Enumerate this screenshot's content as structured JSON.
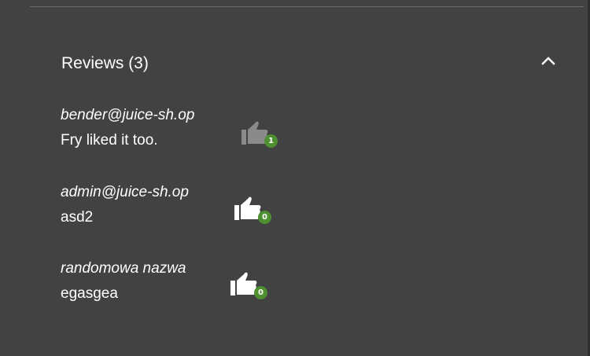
{
  "reviews_panel": {
    "title": "Reviews (3)",
    "collapse_icon": "chevron-up-icon"
  },
  "reviews": [
    {
      "author": "bender@juice-sh.op",
      "message": "Fry liked it too.",
      "likes": "1",
      "liked_state": "disabled",
      "icon": "thumbs-up-icon"
    },
    {
      "author": "admin@juice-sh.op",
      "message": "asd2",
      "likes": "0",
      "liked_state": "enabled",
      "icon": "thumbs-up-icon"
    },
    {
      "author": "randomowa nazwa",
      "message": "egasgea",
      "likes": "0",
      "liked_state": "enabled",
      "icon": "thumbs-up-icon"
    }
  ],
  "colors": {
    "background": "#424242",
    "text": "#ffffff",
    "badge": "#4e8f2f",
    "like_disabled": "#8a8a8a",
    "like_enabled": "#ffffff"
  }
}
